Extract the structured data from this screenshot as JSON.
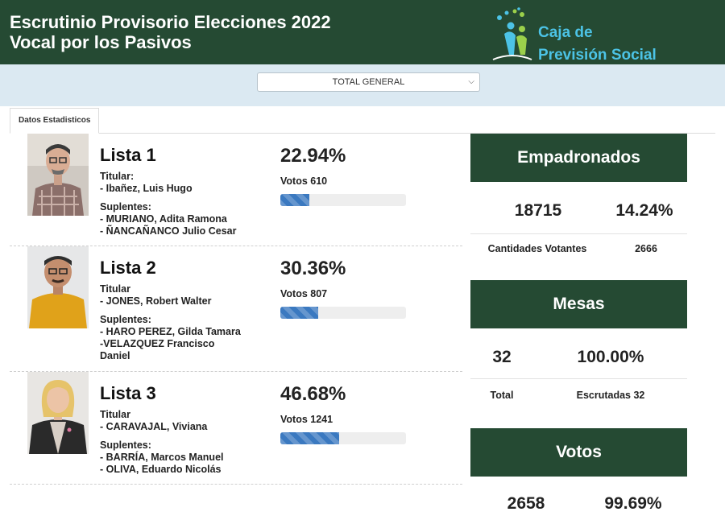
{
  "header": {
    "title_line1": "Escrutinio Provisorio Elecciones 2022",
    "title_line2": "Vocal por los Pasivos",
    "logo_line1": "Caja de",
    "logo_line2": "Previsión Social"
  },
  "filter": {
    "selected": "TOTAL GENERAL"
  },
  "tabs": [
    {
      "label": "Datos Estadisticos"
    }
  ],
  "candidates": [
    {
      "lista": "Lista 1",
      "percent_text": "22.94%",
      "percent": 22.94,
      "votes_text": "Votos 610",
      "titular_label": "Titular:",
      "titular": "- Ibañez, Luis Hugo",
      "suplentes_label": "Suplentes:",
      "suplentes": [
        "- MURIANO, Adita Ramona",
        "- ÑANCAÑANCO Julio Cesar"
      ]
    },
    {
      "lista": "Lista 2",
      "percent_text": "30.36%",
      "percent": 30.36,
      "votes_text": "Votos 807",
      "titular_label": "Titular",
      "titular": "- JONES, Robert Walter",
      "suplentes_label": "Suplentes:",
      "suplentes": [
        "- HARO PEREZ, Gilda Tamara",
        "-VELAZQUEZ Francisco",
        "Daniel"
      ]
    },
    {
      "lista": "Lista 3",
      "percent_text": "46.68%",
      "percent": 46.68,
      "votes_text": "Votos 1241",
      "titular_label": "Titular",
      "titular": "- CARAVAJAL, Viviana",
      "suplentes_label": "Suplentes:",
      "suplentes": [
        "- BARRÍA, Marcos Manuel",
        "- OLIVA, Eduardo Nicolás"
      ]
    }
  ],
  "stats": {
    "empadronados": {
      "title": "Empadronados",
      "value": "18715",
      "percent": "14.24%",
      "label_left": "Cantidades Votantes",
      "label_right": "2666"
    },
    "mesas": {
      "title": "Mesas",
      "value": "32",
      "percent": "100.00%",
      "label_left": "Total",
      "label_right": "Escrutadas 32"
    },
    "votos": {
      "title": "Votos",
      "value": "2658",
      "percent": "99.69%"
    }
  },
  "colors": {
    "header_green": "#254a33",
    "band_blue": "#dbe9f2",
    "progress_blue": "#3b79c0",
    "logo_text": "#4cc3e6"
  }
}
